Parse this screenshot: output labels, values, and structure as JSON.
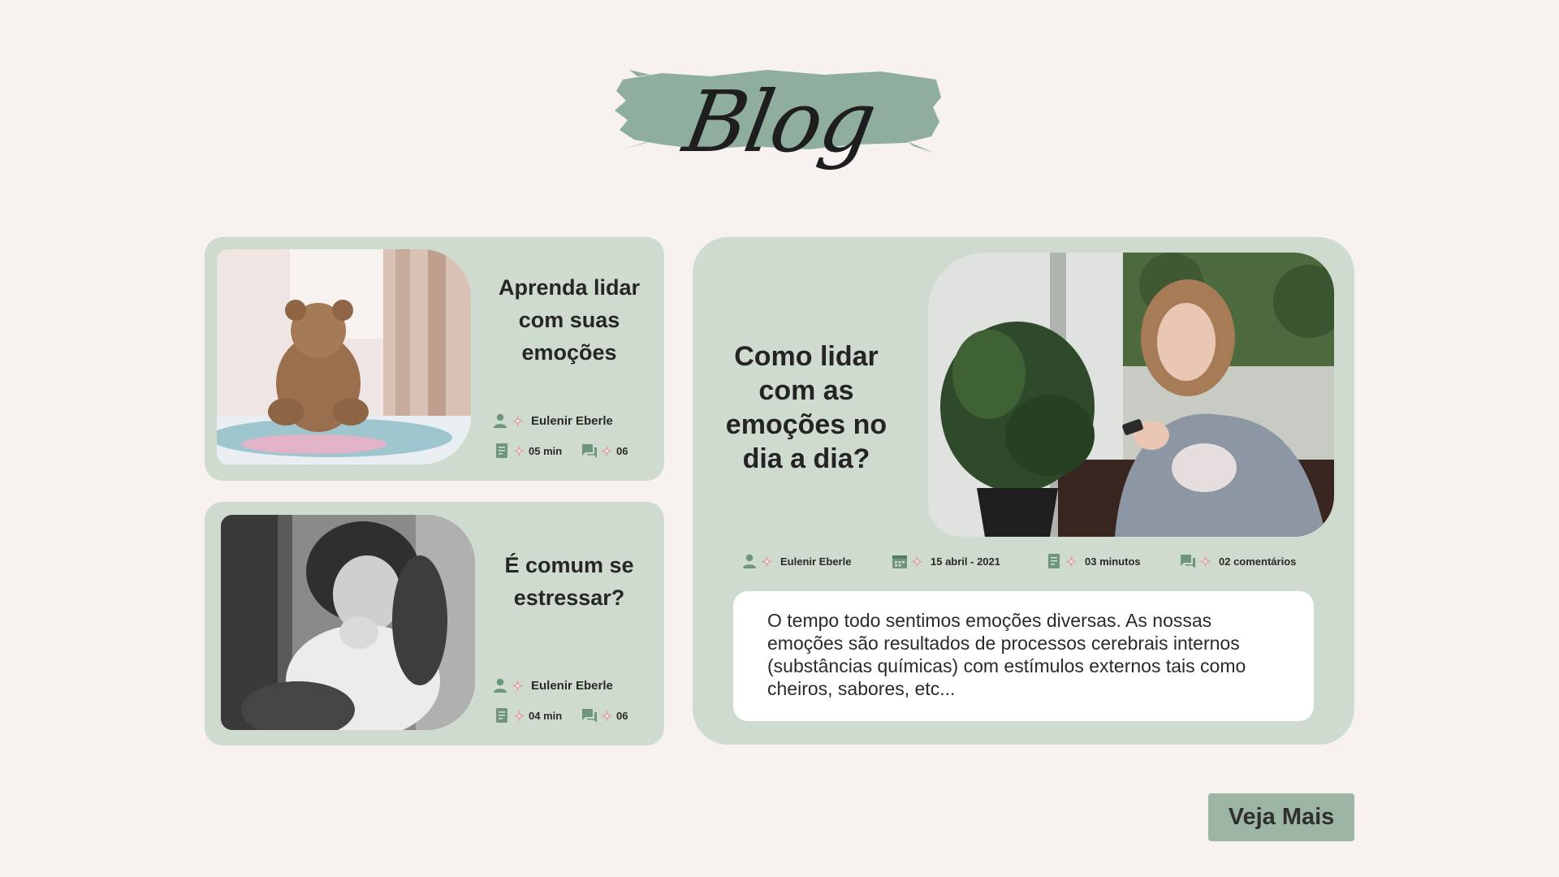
{
  "header": {
    "title": "Blog"
  },
  "theme": {
    "background": "#f7f1f0",
    "card": "#cfdbcf",
    "brush": "#8fae9d",
    "icon": "#6f9580",
    "icon_dot": "#e39a9a",
    "button": "#9db5a4"
  },
  "posts": [
    {
      "title": "Aprenda lidar com suas emoções",
      "author": "Eulenir Eberle",
      "read_time": "05 min",
      "comments": "06",
      "image": "teddy-bear-photo"
    },
    {
      "title": "É comum se estressar?",
      "author": "Eulenir Eberle",
      "read_time": "04 min",
      "comments": "06",
      "image": "stressed-woman-photo"
    }
  ],
  "featured": {
    "title": "Como lidar com as emoções no dia a dia?",
    "author": "Eulenir Eberle",
    "date": "15 abril - 2021",
    "read_time": "03 minutos",
    "comments": "02 comentários",
    "excerpt": "O tempo todo sentimos emoções diversas. As nossas emoções são resultados de processos cerebrais internos (substâncias químicas) com estímulos externos tais como cheiros, sabores, etc...",
    "image": "woman-with-phone-photo"
  },
  "cta": {
    "label": "Veja Mais"
  }
}
